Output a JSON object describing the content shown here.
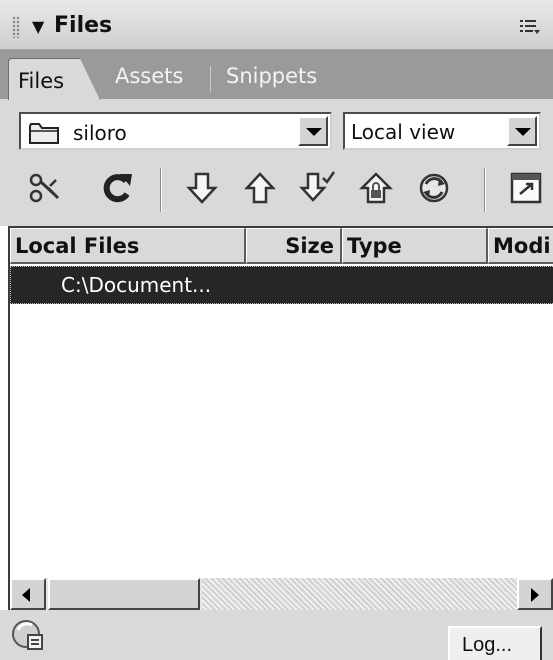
{
  "panel": {
    "title": "Files",
    "collapse_icon": "triangle-down-icon",
    "options_icon": "panel-options-menu-icon"
  },
  "tabs": [
    {
      "label": "Files",
      "active": true
    },
    {
      "label": "Assets",
      "active": false
    },
    {
      "label": "Snippets",
      "active": false
    }
  ],
  "site_select": {
    "value": "siloro",
    "icon": "folder-icon"
  },
  "view_select": {
    "value": "Local view"
  },
  "toolbar": [
    {
      "name": "connect-icon"
    },
    {
      "name": "refresh-icon"
    },
    {
      "name": "get-icon"
    },
    {
      "name": "put-icon"
    },
    {
      "name": "check-out-icon"
    },
    {
      "name": "check-in-icon"
    },
    {
      "name": "synchronize-icon"
    },
    {
      "name": "expand-panel-icon"
    }
  ],
  "columns": [
    {
      "label": "Local Files"
    },
    {
      "label": "Size"
    },
    {
      "label": "Type"
    },
    {
      "label": "Modi"
    }
  ],
  "rows": [
    {
      "label": "C:\\Document...",
      "selected": true
    }
  ],
  "status": {
    "icon": "site-status-icon",
    "log_label": "Log..."
  },
  "colors": {
    "selected_row": "#262626",
    "tab_strip": "#9a9a9a",
    "panel_bg": "#d9d9d9"
  }
}
